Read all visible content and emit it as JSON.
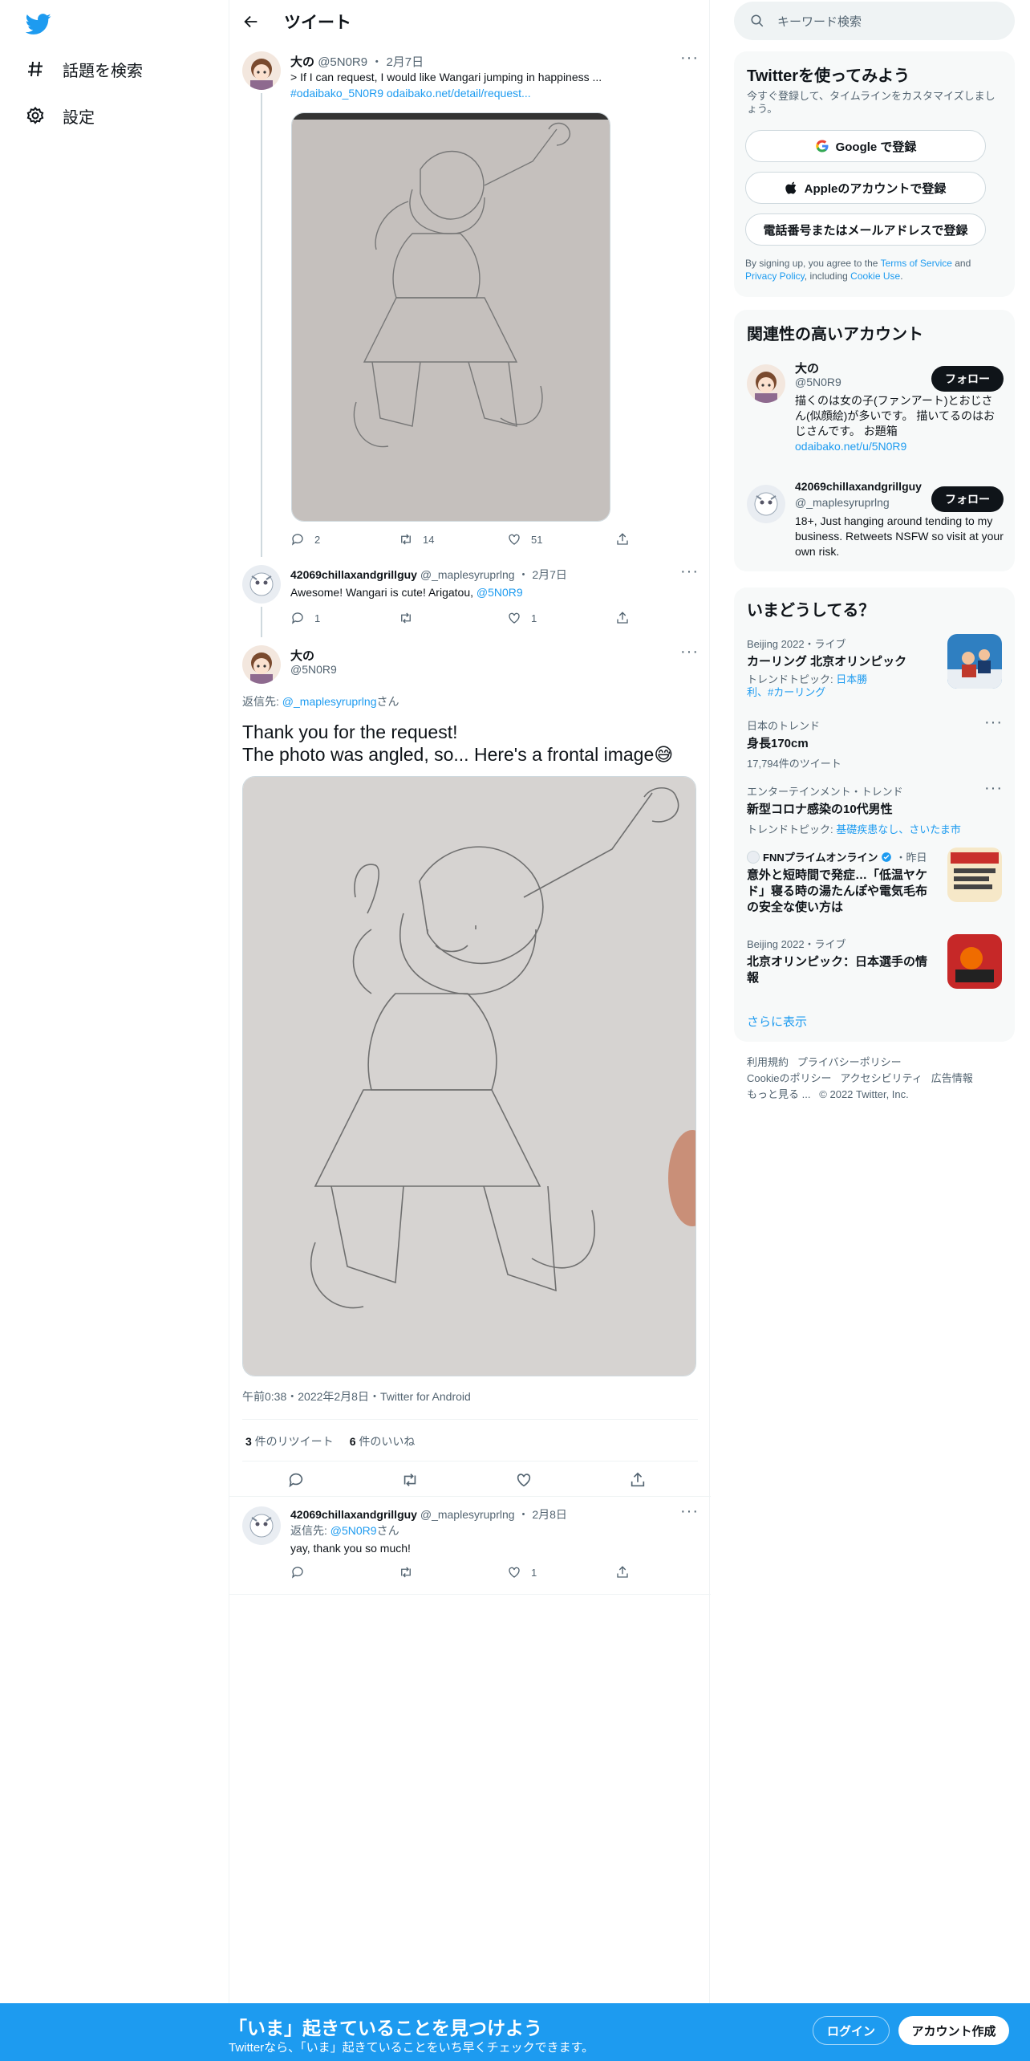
{
  "nav": {
    "items": [
      {
        "label": "話題を検索",
        "icon": "hashtag-icon"
      },
      {
        "label": "設定",
        "icon": "gear-icon"
      }
    ]
  },
  "header": {
    "title": "ツイート"
  },
  "tweets": [
    {
      "name": "大の",
      "handle": "@5N0R9",
      "date": "2月7日",
      "text": "> If I can request, I would like Wangari jumping in happiness ...",
      "links": "#odaibako_5N0R9 odaibako.net/detail/request...",
      "replies": "2",
      "retweets": "14",
      "likes": "51"
    },
    {
      "name": "42069chillaxandgrillguy",
      "handle": "@_maplesyruprlng",
      "date": "2月7日",
      "text": "Awesome! Wangari is cute! Arigatou, ",
      "mention": "@5N0R9",
      "replies": "1",
      "likes": "1"
    }
  ],
  "focused": {
    "name": "大の",
    "handle": "@5N0R9",
    "reply_to_label": "返信先: ",
    "reply_to_handle": "@_maplesyruprlng",
    "reply_to_suffix": "さん",
    "text_line1": "Thank you for the request!",
    "text_line2": "The photo was angled, so... Here's a frontal image😅",
    "timestamp": "午前0:38・2022年2月8日・Twitter for Android",
    "retweet_count": "3",
    "retweet_label": " 件のリツイート",
    "like_count": "6",
    "like_label": " 件のいいね"
  },
  "last_reply": {
    "name": "42069chillaxandgrillguy",
    "handle": "@_maplesyruprlng",
    "date": "2月8日",
    "reply_to_label": "返信先: ",
    "reply_to_handle": "@5N0R9",
    "reply_to_suffix": "さん",
    "text": "yay, thank you so much!",
    "likes": "1"
  },
  "search": {
    "placeholder": "キーワード検索"
  },
  "signup_card": {
    "title": "Twitterを使ってみよう",
    "subtitle": "今すぐ登録して、タイムラインをカスタマイズしましょう。",
    "google": "Google で登録",
    "apple": "Appleのアカウントで登録",
    "phone": "電話番号またはメールアドレスで登録",
    "terms_pre": "By signing up, you agree to the ",
    "terms_link": "Terms of Service",
    "terms_and": " and ",
    "privacy_link": "Privacy Policy",
    "terms_incl": ", including ",
    "cookie_link": "Cookie Use",
    "terms_end": "."
  },
  "relevant": {
    "title": "関連性の高いアカウント",
    "follow": "フォロー",
    "accounts": [
      {
        "name": "大の",
        "handle": "@5N0R9",
        "bio": "描くのは女の子(ファンアート)とおじさん(似顔絵)が多いです。 描いてるのはおじさんです。 お題箱",
        "link": "odaibako.net/u/5N0R9"
      },
      {
        "name": "42069chillaxandgrillguy",
        "handle": "@_maplesyruprlng",
        "bio": "18+, Just hanging around tending to my business. Retweets NSFW so visit at your own risk."
      }
    ]
  },
  "trends": {
    "title": "いまどうしてる？",
    "items": [
      {
        "meta": "Beijing 2022・ライブ",
        "name": "カーリング 北京オリンピック",
        "sub_pre": "トレンドトピック: ",
        "sub_link": "日本勝利、#カーリング"
      },
      {
        "meta": "日本のトレンド",
        "name": "身長170cm",
        "sub": "17,794件のツイート"
      },
      {
        "meta": "エンターテインメント・トレンド",
        "name": "新型コロナ感染の10代男性",
        "sub_pre": "トレンドトピック: ",
        "sub_link": "基礎疾患なし、さいたま市"
      },
      {
        "meta_name": "FNNプライムオンライン",
        "meta_time": "・昨日",
        "name": "意外と短時間で発症…「低温ヤケド」寝る時の湯たんぽや電気毛布の安全な使い方は"
      },
      {
        "meta": "Beijing 2022・ライブ",
        "name": "北京オリンピック：日本選手の情報"
      }
    ],
    "show_more": "さらに表示"
  },
  "footer": {
    "terms": "利用規約",
    "privacy": "プライバシーポリシー",
    "cookie": "Cookieのポリシー",
    "accessibility": "アクセシビリティ",
    "ads": "広告情報",
    "more": "もっと見る ...",
    "copyright": "© 2022 Twitter, Inc."
  },
  "bottom_bar": {
    "title": "「いま」起きていることを見つけよう",
    "subtitle": "Twitterなら、「いま」起きていることをいち早くチェックできます。",
    "login": "ログイン",
    "signup": "アカウント作成"
  },
  "colors": {
    "accent": "#1d9bf0",
    "text": "#0f1419",
    "muted": "#536471"
  }
}
